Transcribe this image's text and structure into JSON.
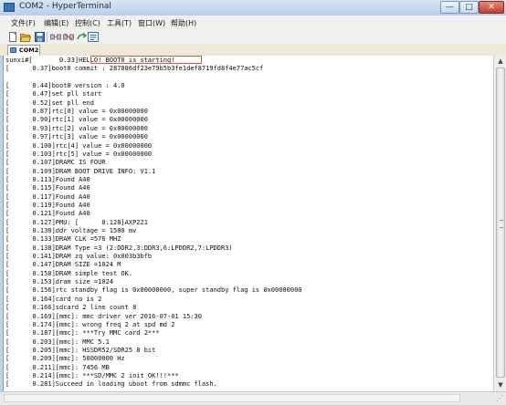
{
  "window": {
    "title": "COM2 - HyperTerminal",
    "min_glyph": "—",
    "max_glyph": "□",
    "close_glyph": "✕"
  },
  "menu": [
    {
      "label": "文件(F)"
    },
    {
      "label": "编辑(E)"
    },
    {
      "label": "控制(C)"
    },
    {
      "label": "工具(T)"
    },
    {
      "label": "窗口(W)"
    },
    {
      "label": "帮助(H)"
    }
  ],
  "toolbar": {
    "icons": [
      "new-session-icon",
      "open-icon",
      "save-icon",
      "disconnect-icon",
      "connect-icon",
      "properties-icon",
      "send-file-icon"
    ],
    "colors": {
      "accent": "#3e74b3",
      "green": "#2e9c3a",
      "red": "#c0392b",
      "yellow": "#e3b530"
    }
  },
  "tab": {
    "label": "COM2"
  },
  "terminal": {
    "highlight_color": "#d85a55",
    "lines": [
      "sunxi#[       0.33]HELLO! BOOT0 is starting!",
      "[      0.37]boot0 commit : 287886df23e79b5b3fe1def8719fd8f4e77ac5cf",
      "",
      "[      0.44]boot0 version : 4.0",
      "[      0.47]set pll start",
      "[      0.52]set pll end",
      "[      0.87]rtc[0] value = 0x00000000",
      "[      0.90]rtc[1] value = 0x00000000",
      "[      0.93]rtc[2] value = 0x00000000",
      "[      0.97]rtc[3] value = 0x00000000",
      "[      0.100]rtc[4] value = 0x00000000",
      "[      0.103]rtc[5] value = 0x00000000",
      "[      0.107]DRAMC IS FOUR",
      "[      0.109]DRAM BOOT DRIVE INFO: V1.1",
      "[      0.113]Found A40",
      "[      0.115]Found A40",
      "[      0.117]Found A40",
      "[      0.119]Found A40",
      "[      0.121]Found A40",
      "[      0.127]PMU: [      0.128]AXP221",
      "[      0.130]ddr voltage = 1500 mv",
      "[      0.133]DRAM CLK =576 MHZ",
      "[      0.138]DRAM Type =3 (2:DDR2,3:DDR3,6:LPDDR2,7:LPDDR3)",
      "[      0.141]DRAM zq value: 0x003b3bfb",
      "[      0.147]DRAM SIZE =1024 M",
      "[      0.150]DRAM simple test OK.",
      "[      0.153]dram size =1024",
      "[      0.156]rtc standby flag is 0x00000000, super standby flag is 0x00000000",
      "[      0.164]card no is 2",
      "[      0.166]sdcard 2 line count 8",
      "[      0.169][mmc]: mmc driver ver 2016-07-01 15:30",
      "[      0.174][mmc]: wrong freq 2 at spd md 2",
      "[      0.187][mmc]: ***Try MMC card 2***",
      "[      0.203][mmc]: MMC 5.1",
      "[      0.205][mmc]: HSSDR52/SDR25 8 bit",
      "[      0.209][mmc]: 50000000 Hz",
      "[      0.211][mmc]: 7456 MB",
      "[      0.214][mmc]: ***SD/MMC 2 init OK!!!***",
      "[      0.281]Succeed in loading uboot from sdmmc flash."
    ]
  }
}
